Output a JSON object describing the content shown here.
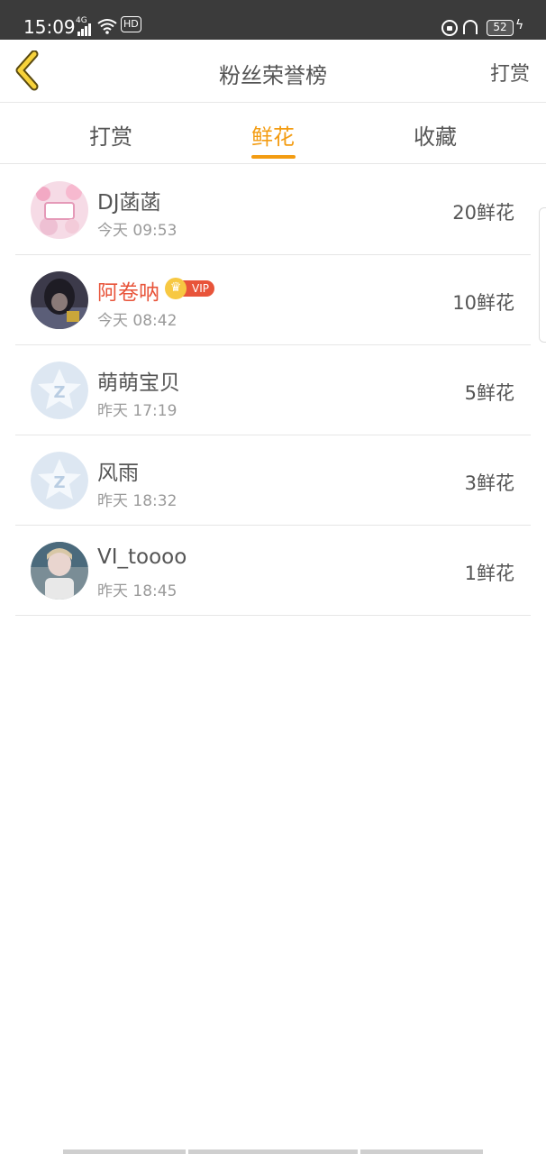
{
  "status": {
    "time": "15:09",
    "network": "4G",
    "hd": "HD",
    "battery": "52"
  },
  "header": {
    "title": "粉丝荣誉榜",
    "right_action": "打赏"
  },
  "tabs": [
    {
      "label": "打赏",
      "active": false
    },
    {
      "label": "鲜花",
      "active": true
    },
    {
      "label": "收藏",
      "active": false
    }
  ],
  "accent_color": "#f39c12",
  "vip_name_color": "#e8543a",
  "list": [
    {
      "name": "DJ菡菡",
      "time": "今天 09:53",
      "count": "20鲜花",
      "avatar": "photo-pink",
      "vip": false
    },
    {
      "name": "阿卷呐",
      "time": "今天 08:42",
      "count": "10鲜花",
      "avatar": "photo-dark",
      "vip": true,
      "vip_label": "VIP"
    },
    {
      "name": "萌萌宝贝",
      "time": "昨天 17:19",
      "count": "5鲜花",
      "avatar": "default-star-avatar",
      "vip": false
    },
    {
      "name": "风雨",
      "time": "昨天 18:32",
      "count": "3鲜花",
      "avatar": "default-star-avatar",
      "vip": false
    },
    {
      "name": "VI_toooo",
      "time": "昨天 18:45",
      "count": "1鲜花",
      "avatar": "photo-person",
      "vip": false
    }
  ]
}
